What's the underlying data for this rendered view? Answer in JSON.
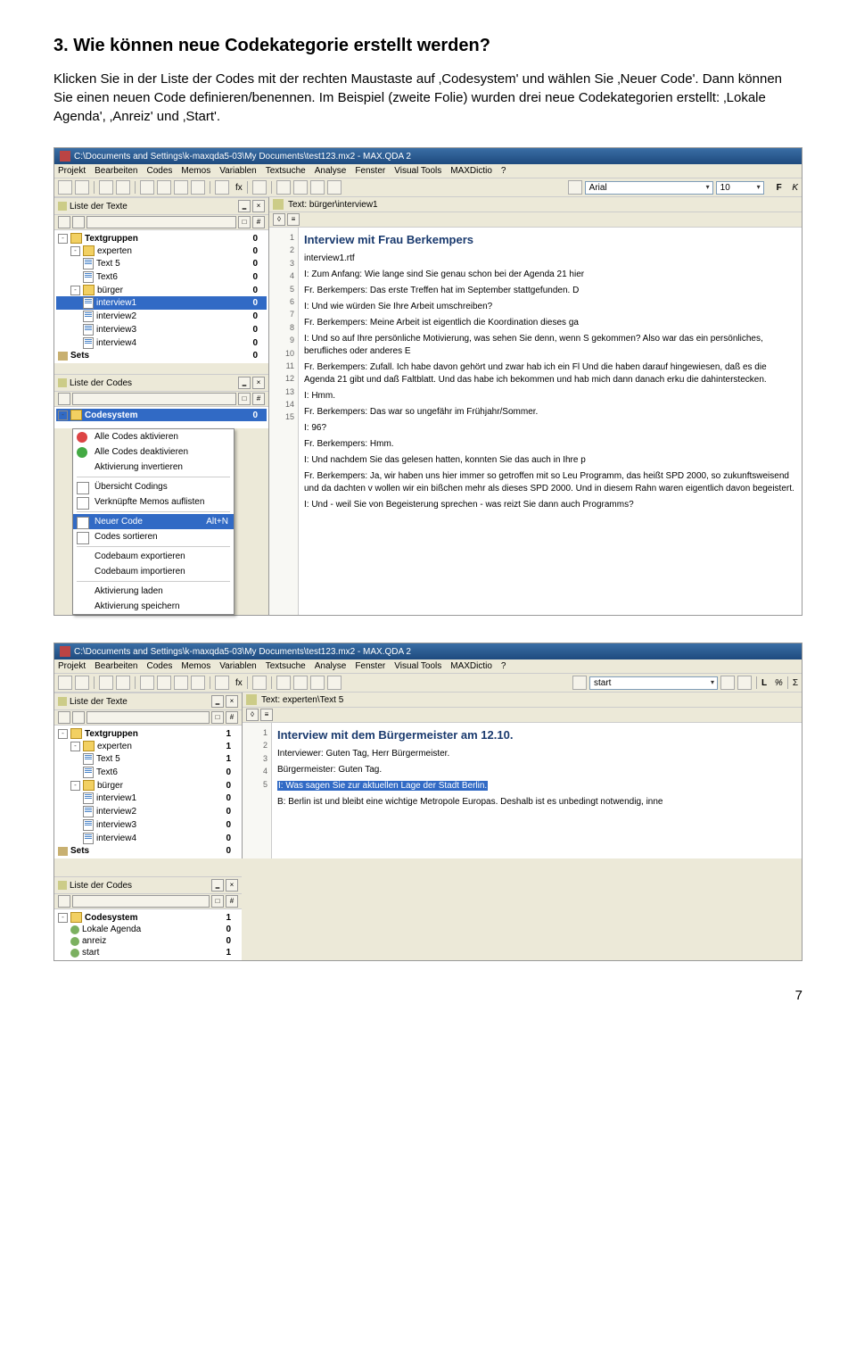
{
  "heading": "3. Wie können neue Codekategorie erstellt werden?",
  "paragraph": "Klicken Sie in der Liste der Codes mit der rechten Maustaste auf ‚Codesystem' und wählen Sie ‚Neuer Code'. Dann können Sie einen neuen Code definieren/benennen. Im Beispiel (zweite Folie) wurden drei neue Codekategorien erstellt: ‚Lokale Agenda', ‚Anreiz' und ‚Start'.",
  "page_num": "7",
  "shot1": {
    "title": "C:\\Documents and Settings\\k-maxqda5-03\\My Documents\\test123.mx2 - MAX.QDA 2",
    "menu": [
      "Projekt",
      "Bearbeiten",
      "Codes",
      "Memos",
      "Variablen",
      "Textsuche",
      "Analyse",
      "Fenster",
      "Visual Tools",
      "MAXDictio",
      "?"
    ],
    "font_combo": "Arial",
    "size_combo": "10",
    "panel_texte": "Liste der Texte",
    "panel_codes": "Liste der Codes",
    "doc_tab": "Text: bürger\\interview1",
    "tree": [
      {
        "label": "Textgruppen",
        "count": "0",
        "bold": true,
        "icon": "folder",
        "exp": "-"
      },
      {
        "label": "experten",
        "count": "0",
        "icon": "folder",
        "indent": 1,
        "exp": "-"
      },
      {
        "label": "Text 5",
        "count": "0",
        "icon": "doc",
        "indent": 2
      },
      {
        "label": "Text6",
        "count": "0",
        "icon": "doc",
        "indent": 2
      },
      {
        "label": "bürger",
        "count": "0",
        "icon": "folder",
        "indent": 1,
        "exp": "-"
      },
      {
        "label": "interview1",
        "count": "0",
        "icon": "doc",
        "indent": 2,
        "sel": true
      },
      {
        "label": "interview2",
        "count": "0",
        "icon": "doc",
        "indent": 2
      },
      {
        "label": "interview3",
        "count": "0",
        "icon": "doc",
        "indent": 2
      },
      {
        "label": "interview4",
        "count": "0",
        "icon": "doc",
        "indent": 2
      },
      {
        "label": "Sets",
        "count": "0",
        "icon": "sets",
        "bold": true
      }
    ],
    "codes_tree": [
      {
        "label": "Codesystem",
        "count": "0",
        "bold": true,
        "sel": true,
        "exp": "-"
      }
    ],
    "context": [
      {
        "label": "Alle Codes aktivieren",
        "icon": "red"
      },
      {
        "label": "Alle Codes deaktivieren",
        "icon": "grn"
      },
      {
        "label": "Aktivierung invertieren"
      },
      {
        "sep": true
      },
      {
        "label": "Übersicht Codings",
        "icon": "box"
      },
      {
        "label": "Verknüpfte Memos auflisten",
        "icon": "box"
      },
      {
        "sep": true
      },
      {
        "label": "Neuer Code",
        "shortcut": "Alt+N",
        "hl": true,
        "icon": "box"
      },
      {
        "label": "Codes sortieren",
        "icon": "box"
      },
      {
        "sep": true
      },
      {
        "label": "Codebaum exportieren"
      },
      {
        "label": "Codebaum importieren"
      },
      {
        "sep": true
      },
      {
        "label": "Aktivierung laden"
      },
      {
        "label": "Aktivierung speichern"
      }
    ],
    "doc": {
      "title": "Interview mit Frau Berkempers",
      "subtitle": "interview1.rtf",
      "lines": [
        {
          "n": "1"
        },
        {
          "n": "2"
        },
        {
          "n": "3",
          "t": "I: Zum Anfang: Wie lange sind Sie genau schon bei der Agenda 21 hier"
        },
        {
          "n": "4",
          "t": "Fr. Berkempers: Das erste Treffen hat im September stattgefunden. D"
        },
        {
          "n": "5",
          "t": "I: Und wie würden Sie Ihre Arbeit umschreiben?"
        },
        {
          "n": "6",
          "t": "Fr. Berkempers: Meine Arbeit ist eigentlich die Koordination dieses ga"
        },
        {
          "n": "7",
          "t": "I: Und so auf Ihre persönliche Motivierung, was sehen Sie denn, wenn S gekommen? Also war das ein persönliches, berufliches oder anderes E"
        },
        {
          "n": "8",
          "t": "Fr. Berkempers: Zufall. Ich habe davon gehört und zwar hab ich ein Fl Und die haben darauf hingewiesen, daß es die Agenda 21 gibt und daß Faltblatt. Und das habe ich bekommen und hab mich dann danach erku die dahinterstecken."
        },
        {
          "n": "9",
          "t": "I: Hmm."
        },
        {
          "n": "10",
          "t": "Fr. Berkempers: Das war so ungefähr im Frühjahr/Sommer."
        },
        {
          "n": "11",
          "t": "I: 96?"
        },
        {
          "n": "12",
          "t": "Fr. Berkempers: Hmm."
        },
        {
          "n": "13",
          "t": "I: Und nachdem Sie das gelesen hatten, konnten Sie das auch in Ihre p"
        },
        {
          "n": "14",
          "t": "Fr. Berkempers: Ja, wir haben uns hier immer so getroffen mit so Leu Programm, das heißt SPD 2000, so zukunftsweisend und da dachten v wollen wir ein bißchen mehr als dieses SPD 2000. Und in diesem Rahn waren eigentlich davon begeistert."
        },
        {
          "n": "15",
          "t": "I: Und - weil Sie von Begeisterung sprechen - was reizt Sie dann auch Programms?"
        }
      ]
    }
  },
  "shot2": {
    "title": "C:\\Documents and Settings\\k-maxqda5-03\\My Documents\\test123.mx2 - MAX.QDA 2",
    "menu": [
      "Projekt",
      "Bearbeiten",
      "Codes",
      "Memos",
      "Variablen",
      "Textsuche",
      "Analyse",
      "Fenster",
      "Visual Tools",
      "MAXDictio",
      "?"
    ],
    "font_combo": "start",
    "panel_texte": "Liste der Texte",
    "panel_codes": "Liste der Codes",
    "doc_tab": "Text: experten\\Text 5",
    "tree": [
      {
        "label": "Textgruppen",
        "count": "1",
        "bold": true,
        "icon": "folder",
        "exp": "-"
      },
      {
        "label": "experten",
        "count": "1",
        "icon": "folder",
        "indent": 1,
        "exp": "-"
      },
      {
        "label": "Text 5",
        "count": "1",
        "icon": "doc",
        "indent": 2
      },
      {
        "label": "Text6",
        "count": "0",
        "icon": "doc",
        "indent": 2
      },
      {
        "label": "bürger",
        "count": "0",
        "icon": "folder",
        "indent": 1,
        "exp": "-"
      },
      {
        "label": "interview1",
        "count": "0",
        "icon": "doc",
        "indent": 2
      },
      {
        "label": "interview2",
        "count": "0",
        "icon": "doc",
        "indent": 2
      },
      {
        "label": "interview3",
        "count": "0",
        "icon": "doc",
        "indent": 2
      },
      {
        "label": "interview4",
        "count": "0",
        "icon": "doc",
        "indent": 2
      },
      {
        "label": "Sets",
        "count": "0",
        "icon": "sets",
        "bold": true
      }
    ],
    "codes_tree": [
      {
        "label": "Codesystem",
        "count": "1",
        "bold": true,
        "exp": "-"
      },
      {
        "label": "Lokale Agenda",
        "count": "0",
        "icon": "code",
        "indent": 1
      },
      {
        "label": "anreiz",
        "count": "0",
        "icon": "code",
        "indent": 1
      },
      {
        "label": "start",
        "count": "1",
        "icon": "code",
        "indent": 1
      }
    ],
    "doc": {
      "title": "Interview mit dem Bürgermeister am 12.10.",
      "lines": [
        {
          "n": "1"
        },
        {
          "n": "2",
          "t": "Interviewer: Guten Tag, Herr Bürgermeister."
        },
        {
          "n": "3",
          "t": "Bürgermeister: Guten Tag."
        },
        {
          "n": "4",
          "t": "I: Was sagen Sie zur aktuellen Lage der Stadt Berlin.",
          "hl": true
        },
        {
          "n": "5",
          "t": "B: Berlin ist und bleibt eine wichtige Metropole Europas. Deshalb ist es unbedingt notwendig, inne"
        }
      ]
    }
  }
}
